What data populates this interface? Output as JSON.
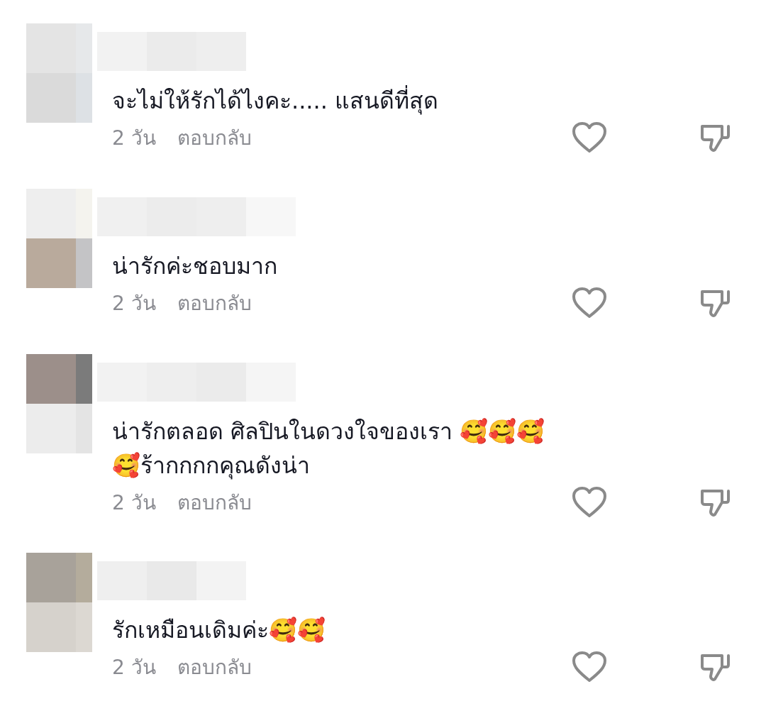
{
  "comments": [
    {
      "text": "จะไม่ให้รักได้ไงคะ..... แสนดีที่สุด",
      "time": "2 วัน",
      "reply": "ตอบกลับ",
      "liked": false
    },
    {
      "text": "น่ารักค่ะชอบมาก",
      "time": "2 วัน",
      "reply": "ตอบกลับ",
      "liked": false
    },
    {
      "text": "น่ารักตลอด ศิลปินในดวงใจของเรา 🥰🥰🥰\n🥰ร้ากกกกคุณดังน่า",
      "time": "2 วัน",
      "reply": "ตอบกลับ",
      "liked": false
    },
    {
      "text": "รักเหมือนเดิมค่ะ🥰🥰",
      "time": "2 วัน",
      "reply": "ตอบกลับ",
      "liked": false
    }
  ]
}
